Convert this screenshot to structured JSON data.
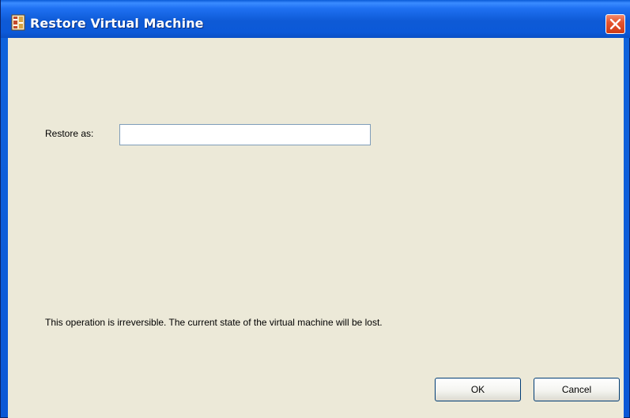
{
  "window": {
    "title": "Restore Virtual Machine",
    "app_icon": "virtual-machine-app-icon",
    "close_icon": "close-icon"
  },
  "form": {
    "restore_as_label": "Restore as:",
    "restore_as_value": "",
    "restore_as_placeholder": ""
  },
  "message": "This operation is irreversible. The current state of the virtual machine will be lost.",
  "buttons": {
    "ok_label": "OK",
    "cancel_label": "Cancel"
  },
  "colors": {
    "titlebar": "#0c59d8",
    "title_text": "#ffffff",
    "client_background": "#ece9d8",
    "close_button": "#e6552f",
    "input_border": "#7f9db9",
    "button_border": "#003c74"
  }
}
